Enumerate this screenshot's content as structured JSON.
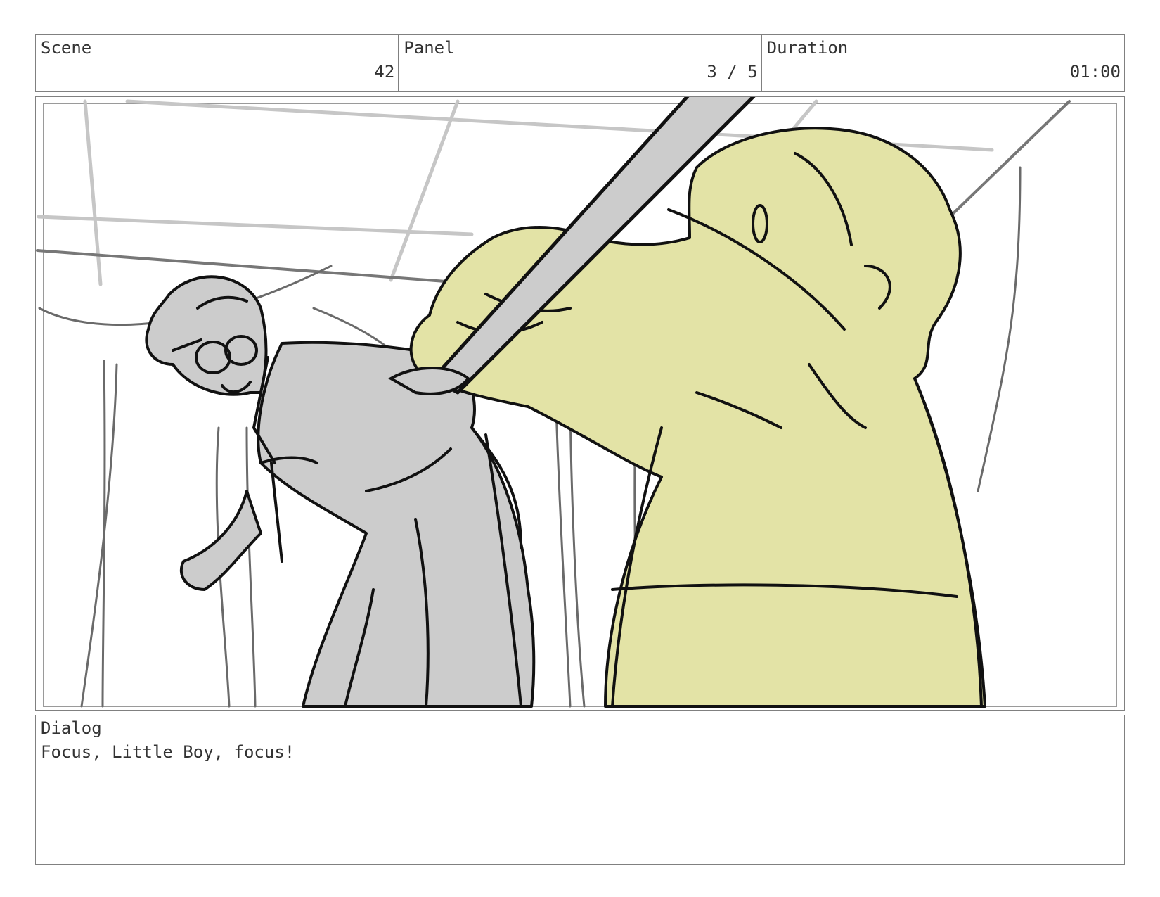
{
  "header": {
    "scene": {
      "label": "Scene",
      "value": "42"
    },
    "panel": {
      "label": "Panel",
      "value": "3 / 5"
    },
    "duration": {
      "label": "Duration",
      "value": "01:00"
    }
  },
  "dialog": {
    "label": "Dialog",
    "text": "Focus, Little Boy, focus!"
  },
  "colors": {
    "border": "#808080",
    "gray_fill": "#cccccc",
    "yellow_fill": "#e3e3a6",
    "ink": "#111111"
  }
}
